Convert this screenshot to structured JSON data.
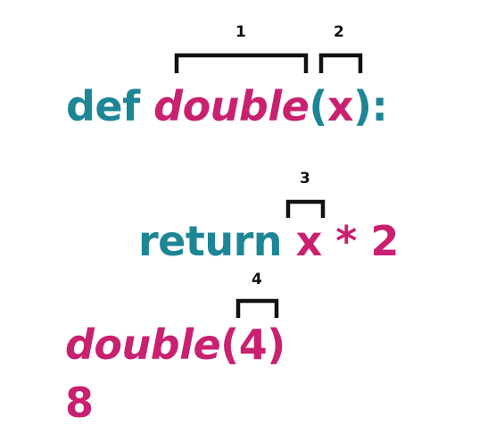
{
  "colors": {
    "teal": "#1d8696",
    "pink": "#c9206f",
    "bracket": "#111111"
  },
  "line1": {
    "keyword": "def",
    "function_name": "double",
    "open_paren": "(",
    "param": "x",
    "close_paren": "):"
  },
  "line2": {
    "keyword": "return",
    "param": "x",
    "operator_expr": "* 2"
  },
  "line3": {
    "function_name": "double",
    "open_paren": "(",
    "arg": "4",
    "close_paren": ")"
  },
  "line4": {
    "result": "8"
  },
  "labels": {
    "one": "1",
    "two": "2",
    "three": "3",
    "four": "4"
  }
}
